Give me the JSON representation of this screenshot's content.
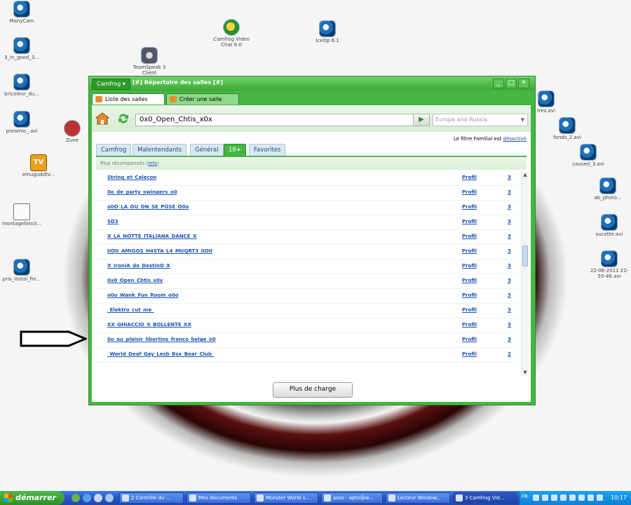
{
  "desktop": {
    "icons": [
      {
        "label": "ManyCam"
      },
      {
        "label": "3_in_good_3..."
      },
      {
        "label": "bricoleur_du..."
      },
      {
        "label": "preamio_.avi"
      },
      {
        "label": "Zune"
      },
      {
        "label": "emuguddtv..."
      },
      {
        "label": "montagefoto3..."
      },
      {
        "label": "pris_instal_fin..."
      },
      {
        "label": "Camfrog Video Chat 6.0"
      },
      {
        "label": "TeamSpeak 3 Client"
      },
      {
        "label": "IceOp 6.1"
      },
      {
        "label": "tres.avi"
      },
      {
        "label": "fonds_2.avi"
      },
      {
        "label": "caused_3.avi"
      },
      {
        "label": "ab_photo..."
      },
      {
        "label": "sucette.avi"
      },
      {
        "label": "22-06-2011 22-55-46.avi"
      }
    ]
  },
  "window": {
    "app_menu": "Camfrog ▾",
    "title": "[#] Répertoire des salles [#]",
    "controls": {
      "min": "_",
      "max": "□",
      "close": "✕"
    },
    "tabs": [
      {
        "label": "Liste des salles"
      },
      {
        "label": "Créer une salle"
      }
    ],
    "search": {
      "value": "0x0_Open_Chtis_x0x"
    },
    "region": {
      "value": "Europe and Russia"
    },
    "filter": {
      "text": "Le filtre Familial est ",
      "link": "désactivé"
    },
    "categories": [
      {
        "label": "Camfrog"
      },
      {
        "label": "Malentendants"
      },
      {
        "label": "Général"
      },
      {
        "label": "18+"
      },
      {
        "label": "Favorites"
      }
    ],
    "recommended": {
      "text": "Plus récompensés (",
      "link": "Info",
      "close": ")"
    },
    "rooms": [
      {
        "name": "String_et_Calecon",
        "profile": "Profil",
        "count": "3"
      },
      {
        "name": "0o_de_party_swingers_o0",
        "profile": "Profil",
        "count": "3"
      },
      {
        "name": "o0O_LA_OU_ON_SE_POSE_O0o",
        "profile": "Profil",
        "count": "3"
      },
      {
        "name": "SD3",
        "profile": "Profil",
        "count": "3"
      },
      {
        "name": "X_LA_NOTTE_ITALIANA_DANCE_X",
        "profile": "Profil",
        "count": "3"
      },
      {
        "name": "IIOII_AMIGOS_H4STA_L4_MUQRT3_IIOII",
        "profile": "Profil",
        "count": "3"
      },
      {
        "name": "X_IroniA_do_DestinO_X",
        "profile": "Profil",
        "count": "3"
      },
      {
        "name": "0x0_Open_Chtis_x0x",
        "profile": "Profil",
        "count": "3"
      },
      {
        "name": "o0o_Wank_Fun_Room_o0o",
        "profile": "Profil",
        "count": "3"
      },
      {
        "name": "_Elektro_cut_me_",
        "profile": "Profil",
        "count": "3"
      },
      {
        "name": "XX_GHIACCIO_X_BOLLENTE_XX",
        "profile": "Profil",
        "count": "3"
      },
      {
        "name": "0o_au_plaisir_libertins_franco_belge_o0",
        "profile": "Profil",
        "count": "3"
      },
      {
        "name": "_World_Deaf_Gay_Lesb_Bsx_Bear_Club_",
        "profile": "Profil",
        "count": "2"
      }
    ],
    "more_button": "Plus de charge"
  },
  "taskbar": {
    "start": "démarrer",
    "items": [
      {
        "label": "2 Contrôle du ..."
      },
      {
        "label": "Mes documents"
      },
      {
        "label": "Monster World s..."
      },
      {
        "label": "asso - apto@w..."
      },
      {
        "label": "Lecteur Window..."
      },
      {
        "label": "3 Camfrog Vid..."
      }
    ],
    "lang": "FR",
    "clock": "10:17"
  },
  "colors": {
    "accent": "#44b63f",
    "link": "#1a53b8",
    "taskbar": "#2554c7"
  }
}
